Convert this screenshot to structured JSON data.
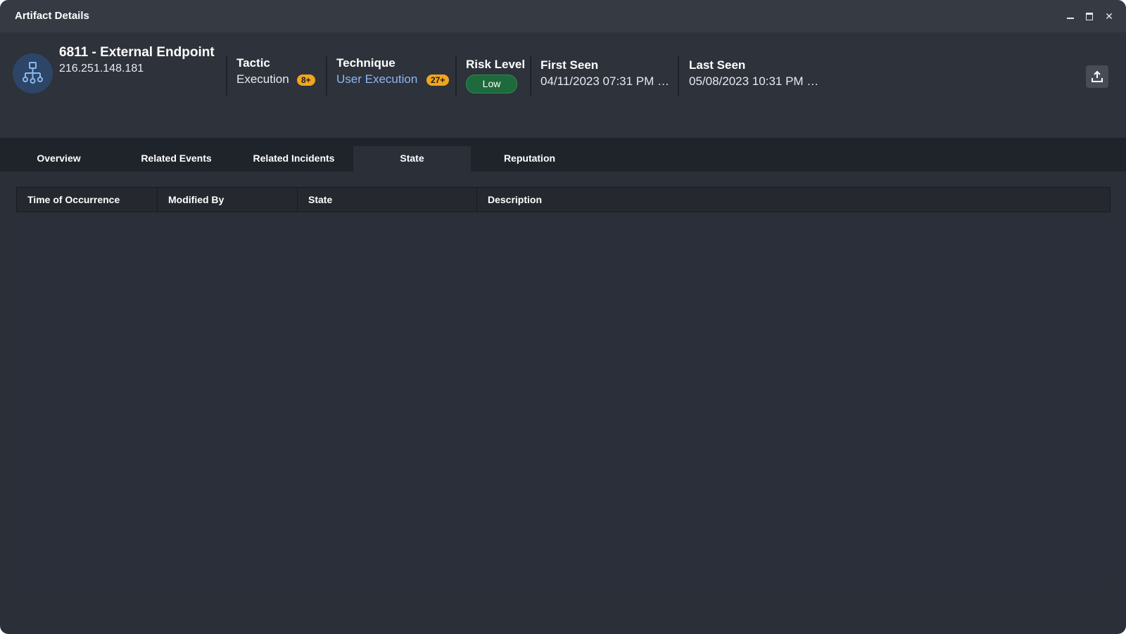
{
  "window": {
    "title": "Artifact Details",
    "controls": {
      "minimize": "minimize-icon",
      "maximize": "maximize-icon",
      "close": "close-icon"
    }
  },
  "header": {
    "icon": "network-hierarchy-icon",
    "entity_name": "6811 - External Endpoint",
    "entity_ip": "216.251.148.181",
    "tactic": {
      "label": "Tactic",
      "value": "Execution",
      "badge": "8+"
    },
    "technique": {
      "label": "Technique",
      "value": "User Execution",
      "badge": "27+"
    },
    "risk": {
      "label": "Risk Level",
      "value": "Low",
      "color": "#1e6a3c"
    },
    "first_seen": {
      "label": "First Seen",
      "value": "04/11/2023 07:31 PM …"
    },
    "last_seen": {
      "label": "Last Seen",
      "value": "05/08/2023 10:31 PM …"
    },
    "export_icon": "export-upload-icon"
  },
  "tabs": [
    {
      "label": "Overview",
      "active": false
    },
    {
      "label": "Related Events",
      "active": false
    },
    {
      "label": "Related Incidents",
      "active": false
    },
    {
      "label": "State",
      "active": true
    },
    {
      "label": "Reputation",
      "active": false
    }
  ],
  "table": {
    "columns": [
      "Time of Occurrence",
      "Modified By",
      "State",
      "Description"
    ],
    "rows": []
  },
  "colors": {
    "badge": "#f2a51c",
    "link": "#8ab8f5",
    "background": "#2b2f38"
  }
}
